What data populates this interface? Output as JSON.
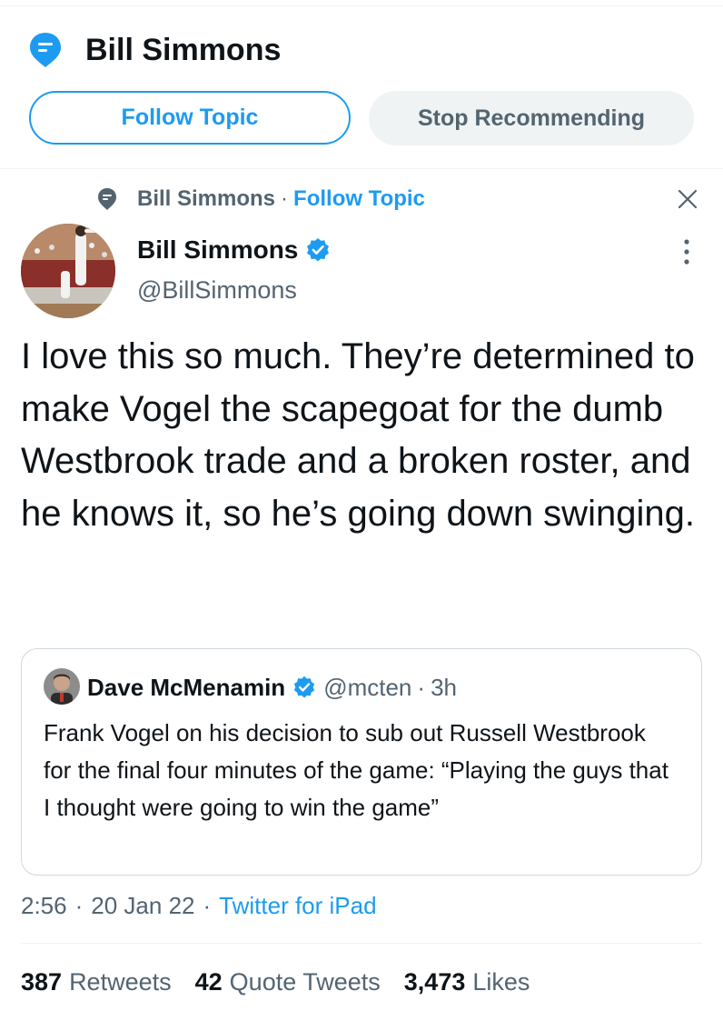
{
  "topic": {
    "title": "Bill Simmons",
    "follow_label": "Follow Topic",
    "stop_label": "Stop Recommending"
  },
  "context": {
    "topic_name": "Bill Simmons",
    "separator": "·",
    "follow_label": "Follow Topic"
  },
  "tweet": {
    "author_name": "Bill Simmons",
    "handle": "@BillSimmons",
    "text": "I love this so much. They’re determined to make Vogel the scapegoat for the dumb Westbrook trade and a broken roster, and he knows it, so he’s going down swinging.",
    "time": "2:56",
    "date": "20 Jan 22",
    "source": "Twitter for iPad",
    "separator": "·"
  },
  "quote": {
    "author_name": "Dave McMenamin",
    "handle": "@mcten",
    "separator": "·",
    "time": "3h",
    "text": "Frank Vogel on his decision to sub out Russell Westbrook for the final four minutes of the game: “Playing the guys that I thought were going to win the game”"
  },
  "stats": {
    "retweets_count": "387",
    "retweets_label": "Retweets",
    "quotes_count": "42",
    "quotes_label": "Quote Tweets",
    "likes_count": "3,473",
    "likes_label": "Likes"
  },
  "colors": {
    "accent": "#1d9bf0",
    "text_primary": "#0f1419",
    "text_secondary": "#536471",
    "border": "#cfd9de",
    "button_bg": "#eff3f4"
  },
  "icons": {
    "topic": "topic-icon",
    "close": "close-icon",
    "more": "more-icon",
    "verified": "verified-icon"
  }
}
